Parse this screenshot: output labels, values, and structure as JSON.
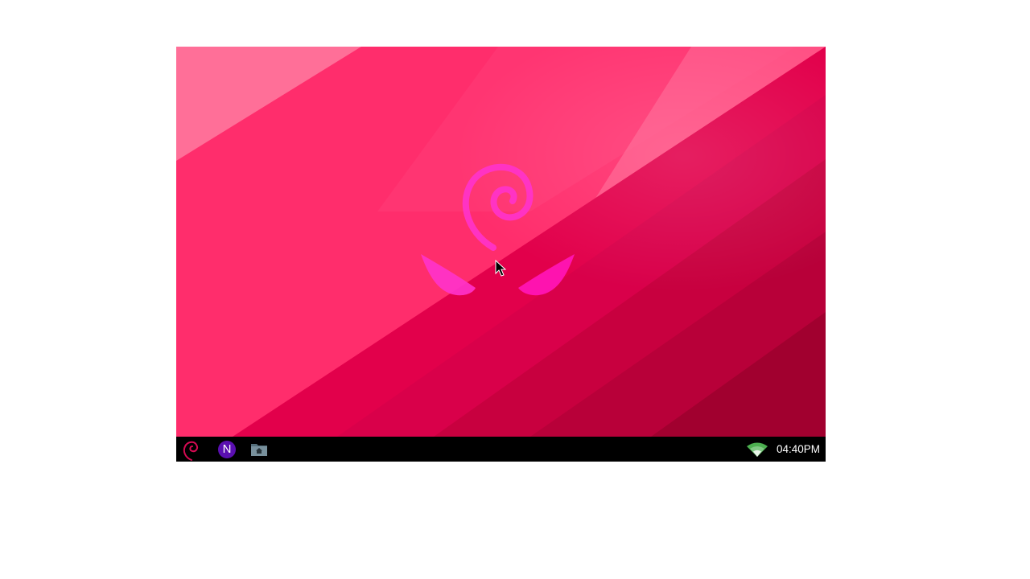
{
  "desktop": {
    "wallpaper_name": "debian-pink-diagonal-wallpaper",
    "colors": {
      "base": "#ff2d6c",
      "light_band": "#ff6a95",
      "dark_band": "#a1002f",
      "logo_pink": "#ff33cc",
      "taskbar": "#000000"
    }
  },
  "taskbar": {
    "menu_icon": "debian-swirl-icon",
    "apps": [
      {
        "icon": "n-app-icon",
        "glyph": "N",
        "color": "#5a0fb0"
      },
      {
        "icon": "home-folder-icon",
        "color": "#607d8b"
      }
    ],
    "tray": {
      "wifi_icon": "wifi-icon",
      "clock": "04:40PM"
    }
  }
}
